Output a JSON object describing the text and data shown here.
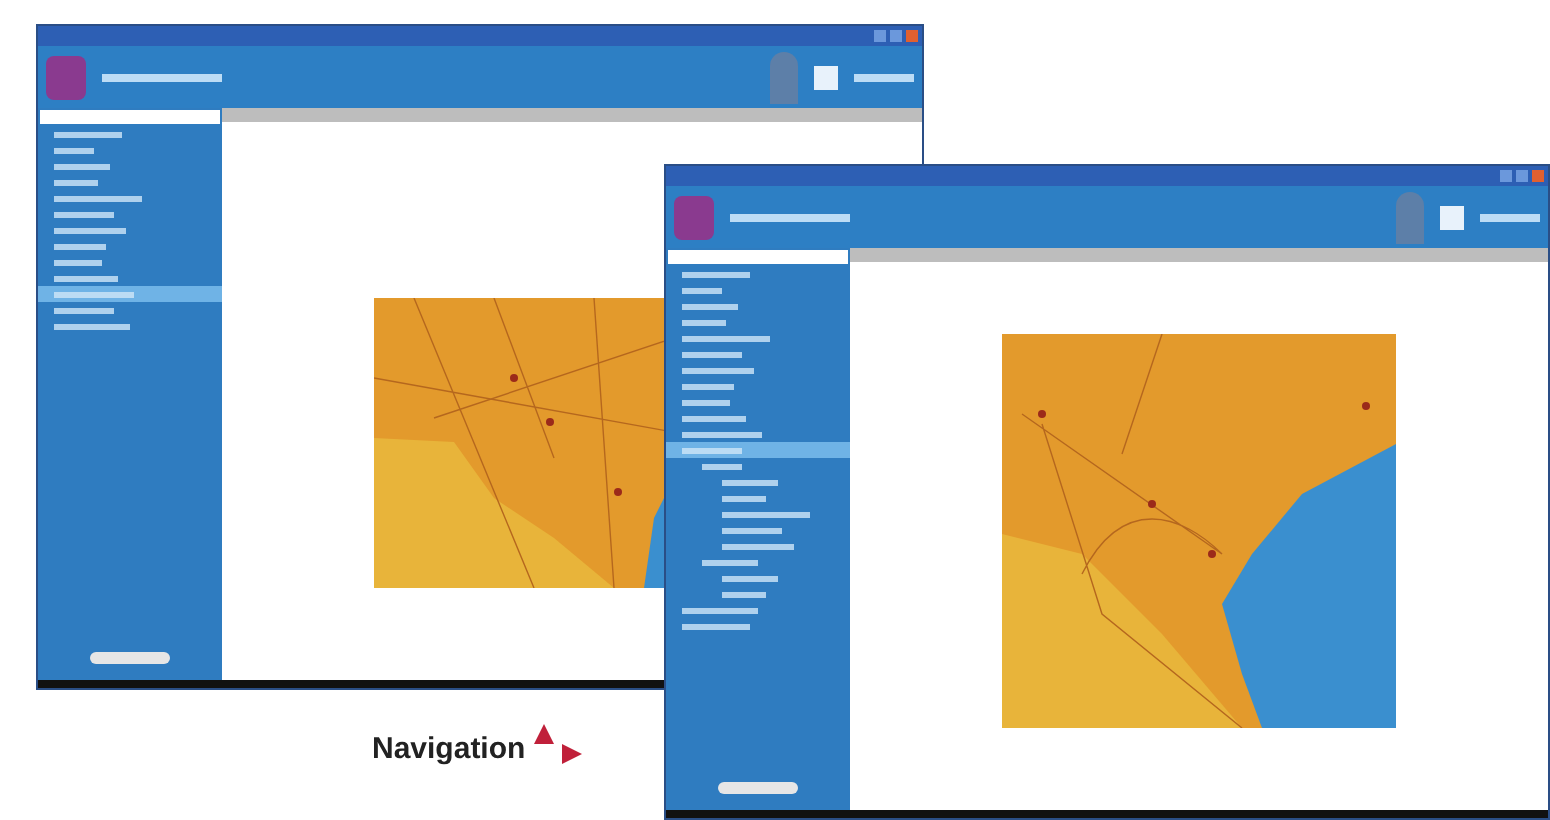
{
  "windows": [
    {
      "map": {
        "kind": "state"
      },
      "sidebar": {
        "items": [
          {
            "selected": false
          },
          {
            "selected": false
          },
          {
            "selected": false
          },
          {
            "selected": false
          },
          {
            "selected": false
          },
          {
            "selected": false
          },
          {
            "selected": false
          },
          {
            "selected": false
          },
          {
            "selected": false
          },
          {
            "selected": false
          },
          {
            "selected": true
          },
          {
            "selected": false
          },
          {
            "selected": false
          }
        ]
      }
    },
    {
      "map": {
        "kind": "coast"
      },
      "sidebar": {
        "items": [
          {
            "selected": false
          },
          {
            "selected": false
          },
          {
            "selected": false
          },
          {
            "selected": false
          },
          {
            "selected": false
          },
          {
            "selected": false
          },
          {
            "selected": false
          },
          {
            "selected": false
          },
          {
            "selected": false
          },
          {
            "selected": false
          },
          {
            "selected": false
          },
          {
            "selected": true,
            "children": [
              {
                "selected": false,
                "children": [
                  {
                    "selected": false
                  },
                  {
                    "selected": false
                  },
                  {
                    "selected": false
                  },
                  {
                    "selected": false
                  },
                  {
                    "selected": false
                  }
                ]
              },
              {
                "selected": false,
                "children": [
                  {
                    "selected": false
                  },
                  {
                    "selected": false
                  }
                ]
              }
            ]
          },
          {
            "selected": false
          },
          {
            "selected": false
          }
        ]
      }
    }
  ],
  "caption": {
    "label": "Navigation"
  }
}
